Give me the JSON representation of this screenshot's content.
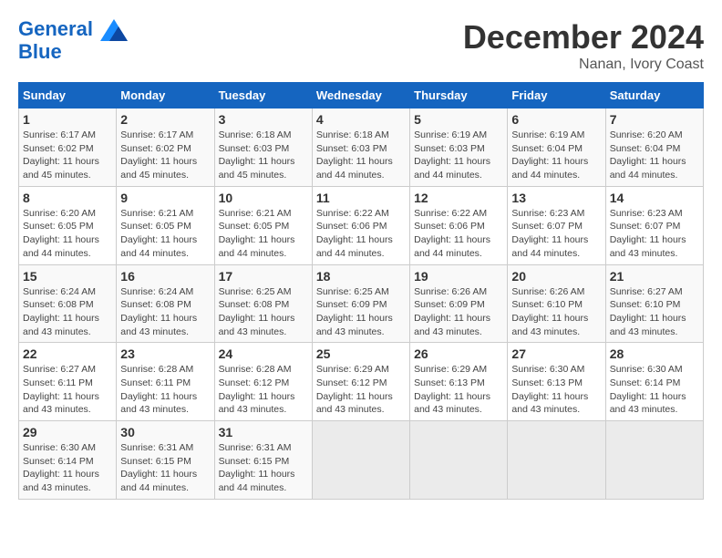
{
  "header": {
    "logo_line1": "General",
    "logo_line2": "Blue",
    "month_title": "December 2024",
    "location": "Nanan, Ivory Coast"
  },
  "weekdays": [
    "Sunday",
    "Monday",
    "Tuesday",
    "Wednesday",
    "Thursday",
    "Friday",
    "Saturday"
  ],
  "weeks": [
    [
      {
        "day": "1",
        "sunrise": "6:17 AM",
        "sunset": "6:02 PM",
        "daylight": "11 hours and 45 minutes."
      },
      {
        "day": "2",
        "sunrise": "6:17 AM",
        "sunset": "6:02 PM",
        "daylight": "11 hours and 45 minutes."
      },
      {
        "day": "3",
        "sunrise": "6:18 AM",
        "sunset": "6:03 PM",
        "daylight": "11 hours and 45 minutes."
      },
      {
        "day": "4",
        "sunrise": "6:18 AM",
        "sunset": "6:03 PM",
        "daylight": "11 hours and 44 minutes."
      },
      {
        "day": "5",
        "sunrise": "6:19 AM",
        "sunset": "6:03 PM",
        "daylight": "11 hours and 44 minutes."
      },
      {
        "day": "6",
        "sunrise": "6:19 AM",
        "sunset": "6:04 PM",
        "daylight": "11 hours and 44 minutes."
      },
      {
        "day": "7",
        "sunrise": "6:20 AM",
        "sunset": "6:04 PM",
        "daylight": "11 hours and 44 minutes."
      }
    ],
    [
      {
        "day": "8",
        "sunrise": "6:20 AM",
        "sunset": "6:05 PM",
        "daylight": "11 hours and 44 minutes."
      },
      {
        "day": "9",
        "sunrise": "6:21 AM",
        "sunset": "6:05 PM",
        "daylight": "11 hours and 44 minutes."
      },
      {
        "day": "10",
        "sunrise": "6:21 AM",
        "sunset": "6:05 PM",
        "daylight": "11 hours and 44 minutes."
      },
      {
        "day": "11",
        "sunrise": "6:22 AM",
        "sunset": "6:06 PM",
        "daylight": "11 hours and 44 minutes."
      },
      {
        "day": "12",
        "sunrise": "6:22 AM",
        "sunset": "6:06 PM",
        "daylight": "11 hours and 44 minutes."
      },
      {
        "day": "13",
        "sunrise": "6:23 AM",
        "sunset": "6:07 PM",
        "daylight": "11 hours and 44 minutes."
      },
      {
        "day": "14",
        "sunrise": "6:23 AM",
        "sunset": "6:07 PM",
        "daylight": "11 hours and 43 minutes."
      }
    ],
    [
      {
        "day": "15",
        "sunrise": "6:24 AM",
        "sunset": "6:08 PM",
        "daylight": "11 hours and 43 minutes."
      },
      {
        "day": "16",
        "sunrise": "6:24 AM",
        "sunset": "6:08 PM",
        "daylight": "11 hours and 43 minutes."
      },
      {
        "day": "17",
        "sunrise": "6:25 AM",
        "sunset": "6:08 PM",
        "daylight": "11 hours and 43 minutes."
      },
      {
        "day": "18",
        "sunrise": "6:25 AM",
        "sunset": "6:09 PM",
        "daylight": "11 hours and 43 minutes."
      },
      {
        "day": "19",
        "sunrise": "6:26 AM",
        "sunset": "6:09 PM",
        "daylight": "11 hours and 43 minutes."
      },
      {
        "day": "20",
        "sunrise": "6:26 AM",
        "sunset": "6:10 PM",
        "daylight": "11 hours and 43 minutes."
      },
      {
        "day": "21",
        "sunrise": "6:27 AM",
        "sunset": "6:10 PM",
        "daylight": "11 hours and 43 minutes."
      }
    ],
    [
      {
        "day": "22",
        "sunrise": "6:27 AM",
        "sunset": "6:11 PM",
        "daylight": "11 hours and 43 minutes."
      },
      {
        "day": "23",
        "sunrise": "6:28 AM",
        "sunset": "6:11 PM",
        "daylight": "11 hours and 43 minutes."
      },
      {
        "day": "24",
        "sunrise": "6:28 AM",
        "sunset": "6:12 PM",
        "daylight": "11 hours and 43 minutes."
      },
      {
        "day": "25",
        "sunrise": "6:29 AM",
        "sunset": "6:12 PM",
        "daylight": "11 hours and 43 minutes."
      },
      {
        "day": "26",
        "sunrise": "6:29 AM",
        "sunset": "6:13 PM",
        "daylight": "11 hours and 43 minutes."
      },
      {
        "day": "27",
        "sunrise": "6:30 AM",
        "sunset": "6:13 PM",
        "daylight": "11 hours and 43 minutes."
      },
      {
        "day": "28",
        "sunrise": "6:30 AM",
        "sunset": "6:14 PM",
        "daylight": "11 hours and 43 minutes."
      }
    ],
    [
      {
        "day": "29",
        "sunrise": "6:30 AM",
        "sunset": "6:14 PM",
        "daylight": "11 hours and 43 minutes."
      },
      {
        "day": "30",
        "sunrise": "6:31 AM",
        "sunset": "6:15 PM",
        "daylight": "11 hours and 44 minutes."
      },
      {
        "day": "31",
        "sunrise": "6:31 AM",
        "sunset": "6:15 PM",
        "daylight": "11 hours and 44 minutes."
      },
      null,
      null,
      null,
      null
    ]
  ]
}
